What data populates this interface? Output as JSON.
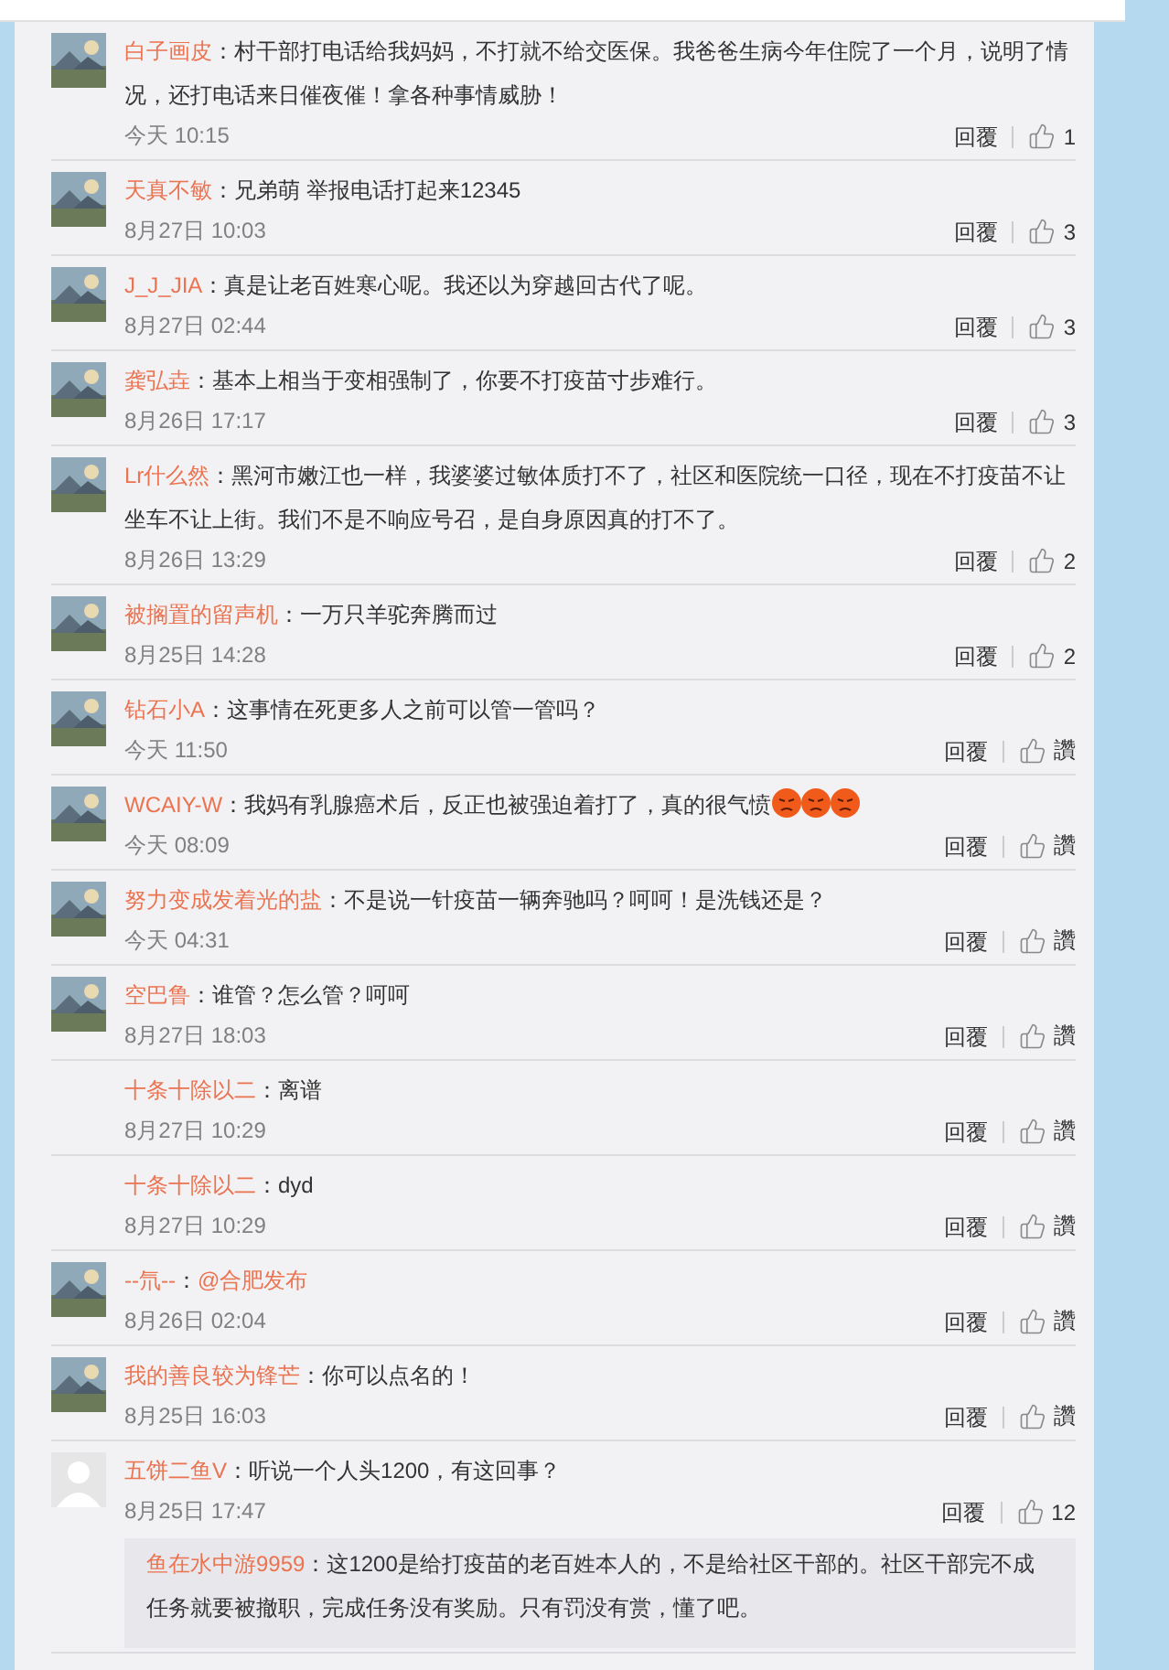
{
  "comments": [
    {
      "author": "白子画皮",
      "separator": "：",
      "text": "村干部打电话给我妈妈，不打就不给交医保。我爸爸生病今年住院了一个月，说明了情况，还打电话来日催夜催！拿各种事情威胁！",
      "time": "今天 10:15",
      "reply": "回覆",
      "like": "1"
    },
    {
      "author": "天真不敏",
      "separator": "：",
      "text": "兄弟萌 举报电话打起来12345",
      "time": "8月27日 10:03",
      "reply": "回覆",
      "like": "3"
    },
    {
      "author": "J_J_JIA",
      "separator": "：",
      "text": "真是让老百姓寒心呢。我还以为穿越回古代了呢。",
      "time": "8月27日 02:44",
      "reply": "回覆",
      "like": "3"
    },
    {
      "author": "龚弘垚",
      "separator": "：",
      "text": "基本上相当于变相强制了，你要不打疫苗寸步难行。",
      "time": "8月26日 17:17",
      "reply": "回覆",
      "like": "3"
    },
    {
      "author": "Lr什么然",
      "separator": "：",
      "text": "黑河市嫩江也一样，我婆婆过敏体质打不了，社区和医院统一口径，现在不打疫苗不让坐车不让上街。我们不是不响应号召，是自身原因真的打不了。",
      "time": "8月26日 13:29",
      "reply": "回覆",
      "like": "2"
    },
    {
      "author": "被搁置的留声机",
      "separator": "：",
      "text": "一万只羊驼奔腾而过",
      "time": "8月25日 14:28",
      "reply": "回覆",
      "like": "2"
    },
    {
      "author": "钻石小A",
      "separator": "：",
      "text": "这事情在死更多人之前可以管一管吗？",
      "time": "今天 11:50",
      "reply": "回覆",
      "like": "讚"
    },
    {
      "author": "WCAIY-W",
      "separator": "：",
      "text": "我妈有乳腺癌术后，反正也被强迫着打了，真的很气愤",
      "emojis": [
        {
          "kind": "angry-face"
        },
        {
          "kind": "angry-face"
        },
        {
          "kind": "angry-face"
        }
      ],
      "time": "今天 08:09",
      "reply": "回覆",
      "like": "讚"
    },
    {
      "author": "努力变成发着光的盐",
      "separator": "：",
      "text": "不是说一针疫苗一辆奔驰吗？呵呵！是洗钱还是？",
      "time": "今天 04:31",
      "reply": "回覆",
      "like": "讚"
    },
    {
      "author": "空巴鲁",
      "separator": "：",
      "text": "谁管？怎么管？呵呵",
      "time": "8月27日 18:03",
      "reply": "回覆",
      "like": "讚"
    },
    {
      "author": "十条十除以二",
      "separator": "：",
      "text": "离谱",
      "time": "8月27日 10:29",
      "reply": "回覆",
      "like": "讚"
    },
    {
      "author": "十条十除以二",
      "separator": "：",
      "text": "dyd",
      "time": "8月27日 10:29",
      "reply": "回覆",
      "like": "讚"
    },
    {
      "author": "--氘--",
      "separator": "：",
      "mention": "@合肥发布",
      "time": "8月26日 02:04",
      "reply": "回覆",
      "like": "讚"
    },
    {
      "author": "我的善良较为锋芒",
      "separator": "：",
      "text": "你可以点名的！",
      "time": "8月25日 16:03",
      "reply": "回覆",
      "like": "讚"
    },
    {
      "avatar": {
        "kind": "default"
      },
      "author": "五饼二鱼V",
      "separator": "：",
      "text": "听说一个人头1200，有这回事？",
      "time": "8月25日 17:47",
      "reply": "回覆",
      "like": "12",
      "replies": [
        {
          "author": "鱼在水中游9959",
          "separator": "：",
          "text": "这1200是给打疫苗的老百姓本人的，不是给社区干部的。社区干部完不成任务就要被撤职，完成任务没有奖励。只有罚没有赏，懂了吧。"
        }
      ]
    }
  ]
}
